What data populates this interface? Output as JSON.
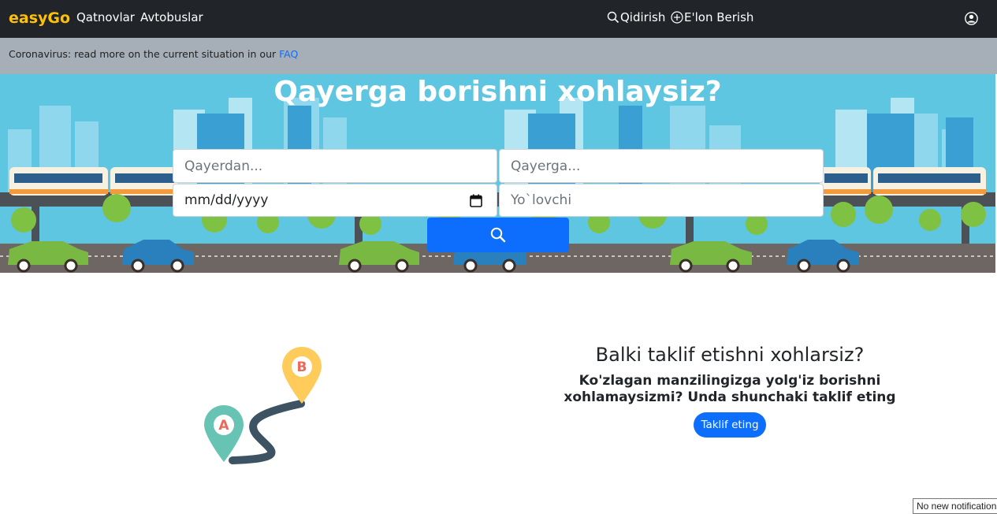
{
  "navbar": {
    "brand": "easyGo",
    "links": [
      "Qatnovlar",
      "Avtobuslar"
    ],
    "search_label": "Qidirish",
    "post_label": "E'lon Berish",
    "icons": {
      "search": "search-icon",
      "post": "plus-circle-icon",
      "user": "user-circle-icon"
    }
  },
  "alert": {
    "text": "Coronavirus: read more on the current situation in our ",
    "link": "FAQ"
  },
  "hero": {
    "title": "Qayerga borishni xohlaysiz?",
    "from_placeholder": "Qayerdan...",
    "to_placeholder": "Qayerga...",
    "date_value": "mm/dd/yyyy",
    "passenger_placeholder": "Yo`lovchi",
    "search_icon": "search-icon"
  },
  "promo": {
    "marker_a": "A",
    "marker_b": "B",
    "title": "Balki taklif etishni xohlarsiz?",
    "subtitle": "Ko'zlagan manzilingizga yolg'iz borishni xohlamaysizmi? Unda shunchaki taklif eting",
    "button": "Taklif eting"
  },
  "notification": "No new notifications",
  "colors": {
    "navbar": "#212529",
    "brand": "#ffc107",
    "primary": "#0d6efd",
    "alert": "#a6aeb7",
    "sky": "#5fc6e1"
  }
}
